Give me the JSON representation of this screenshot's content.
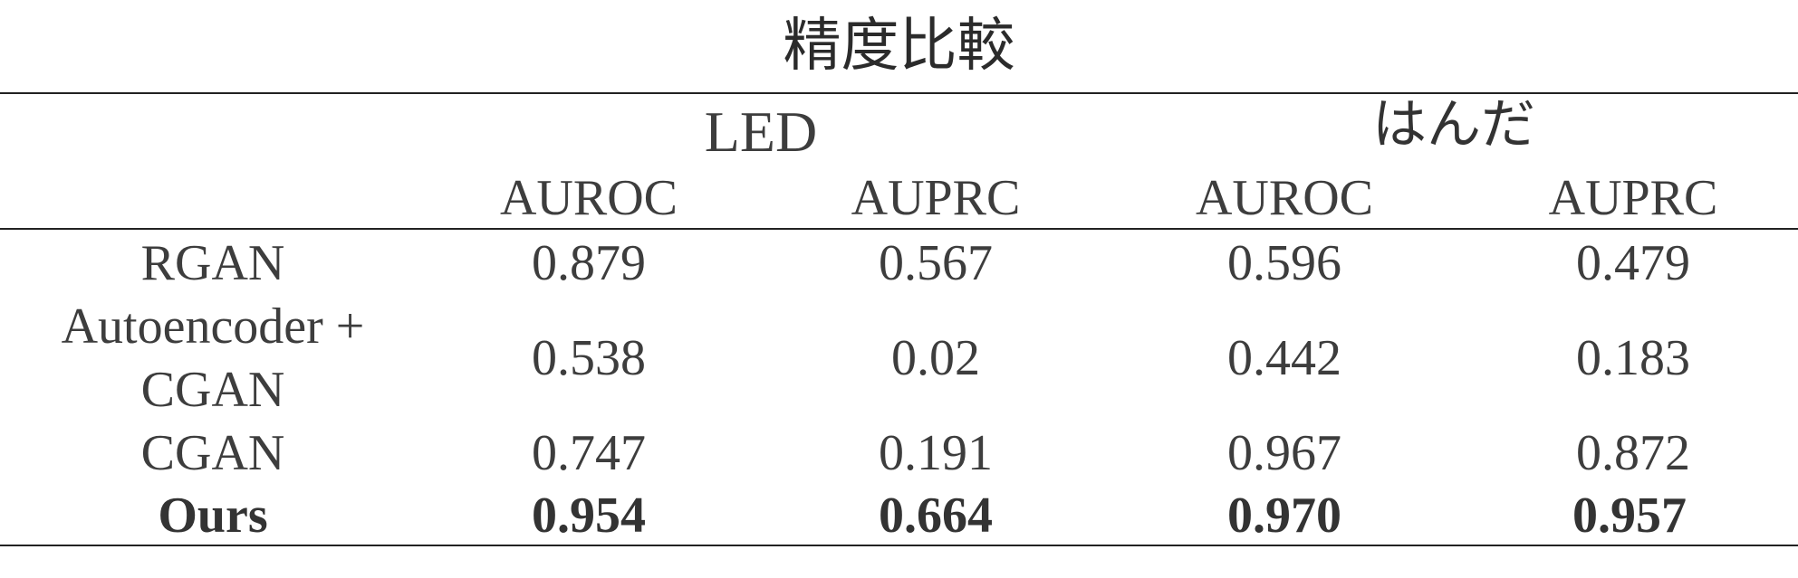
{
  "title": "精度比較",
  "groups": [
    "LED",
    "はんだ"
  ],
  "metrics": [
    "AUROC",
    "AUPRC",
    "AUROC",
    "AUPRC"
  ],
  "rows": [
    {
      "method": "RGAN",
      "values": [
        "0.879",
        "0.567",
        "0.596",
        "0.479"
      ]
    },
    {
      "method_line1": "Autoencoder +",
      "method_line2": "CGAN",
      "values": [
        "0.538",
        "0.02",
        "0.442",
        "0.183"
      ]
    },
    {
      "method": "CGAN",
      "values": [
        "0.747",
        "0.191",
        "0.967",
        "0.872"
      ]
    },
    {
      "method": "Ours",
      "values": [
        "0.954",
        "0.664",
        "0.970",
        "0.957"
      ]
    }
  ]
}
